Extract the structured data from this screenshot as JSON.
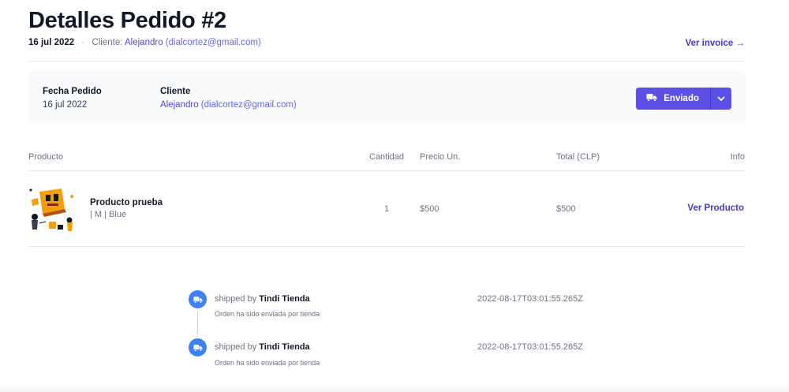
{
  "header": {
    "title": "Detalles Pedido #2",
    "date": "16 jul 2022",
    "separator": "·",
    "client_label": "Cliente:",
    "client_name": "Alejandro",
    "client_email": "(dialcortez@gmail.com)",
    "invoice_link": "Ver invoice →"
  },
  "summary": {
    "order_date_label": "Fecha Pedido",
    "order_date_value": "16 jul 2022",
    "client_label": "Cliente",
    "client_name": "Alejandro",
    "client_email": "(dialcortez@gmail.com)",
    "status_button": "Enviado",
    "status_icon": "truck-icon",
    "dropdown_icon": "chevron-down-icon"
  },
  "table": {
    "headers": {
      "product": "Producto",
      "quantity": "Cantidad",
      "unit_price": "Precio Un.",
      "total": "Total (CLP)",
      "info": "Info"
    },
    "rows": [
      {
        "name": "Producto prueba",
        "variant": "| M | Blue",
        "quantity": "1",
        "unit_price": "$500",
        "total": "$500",
        "link": "Ver Producto"
      }
    ]
  },
  "timeline": [
    {
      "prefix": "shipped by",
      "actor": "Tindi Tienda",
      "description": "Orden ha sido enviada por tienda",
      "timestamp": "2022-08-17T03:01:55.265Z",
      "icon": "truck-icon"
    },
    {
      "prefix": "shipped by",
      "actor": "Tindi Tienda",
      "description": "Orden ha sido enviada por tienda",
      "timestamp": "2022-08-17T03:01:55.265Z",
      "icon": "truck-icon"
    }
  ],
  "colors": {
    "accent": "#4f46e5",
    "button": "#5b4fe6",
    "timeline_icon": "#3b82f6",
    "product_orange": "#f59e0b"
  }
}
